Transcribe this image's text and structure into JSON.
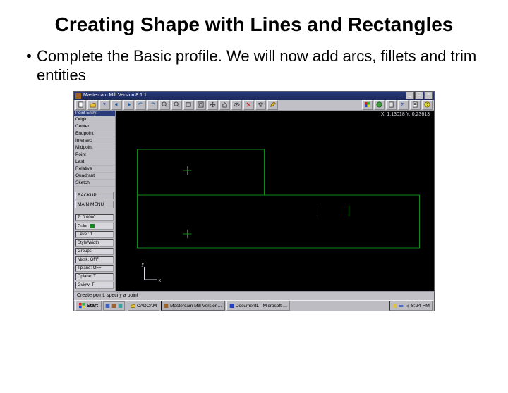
{
  "slide": {
    "title": "Creating Shape with Lines and Rectangles",
    "bullet_dot": "•",
    "bullet_text": "Complete the Basic profile. We will now add arcs, fillets and trim entities"
  },
  "window": {
    "title": "Mastercam Mill Version 8.1.1",
    "min_btn": "_",
    "max_btn": "□",
    "close_btn": "×"
  },
  "toolbar": {
    "icons": [
      "file-icon",
      "open-icon",
      "help-icon",
      "back-icon",
      "forward-icon",
      "undo-icon",
      "redo-icon",
      "zoom-in-icon",
      "zoom-out-icon",
      "zoom-window-icon",
      "fit-icon",
      "pan-icon",
      "home-icon",
      "view-icon",
      "delete-icon",
      "layers-icon",
      "modify-icon",
      "color-icon",
      "globe-icon",
      "calc-icon",
      "stats-icon",
      "report-icon",
      "question-icon"
    ]
  },
  "sidebar": {
    "panel_title": "Point Entry:",
    "items": [
      "Origin",
      "Center",
      "Endpoint",
      "Intersec",
      "Midpoint",
      "Point",
      "Last",
      "Relative",
      "Quadrant",
      "Sketch"
    ],
    "backup_btn": "BACKUP",
    "main_menu_btn": "MAIN MENU",
    "status": [
      {
        "label": "Z:",
        "value": "0.0000"
      },
      {
        "label": "Color:",
        "value": "10"
      },
      {
        "label": "Level:",
        "value": "1"
      },
      {
        "label": "Style/Width",
        "value": ""
      },
      {
        "label": "Groups:",
        "value": ""
      },
      {
        "label": "Mask:",
        "value": "OFF"
      },
      {
        "label": "Tplane:",
        "value": "OFF"
      },
      {
        "label": "Cplane:",
        "value": "T"
      },
      {
        "label": "Gview:",
        "value": "T"
      }
    ]
  },
  "canvas": {
    "coord": "X: 1.13018  Y: 0.23613",
    "axis_x": "x",
    "axis_y": "y"
  },
  "status_bar": {
    "text": "Create point: specify a point"
  },
  "taskbar": {
    "start": "Start",
    "tasks": [
      {
        "label": "CADCAM",
        "active": false
      },
      {
        "label": "Mastercam Mill Version…",
        "active": true
      },
      {
        "label": "DocumentL - Microsoft …",
        "active": false
      }
    ],
    "clock": "8:24 PM"
  }
}
